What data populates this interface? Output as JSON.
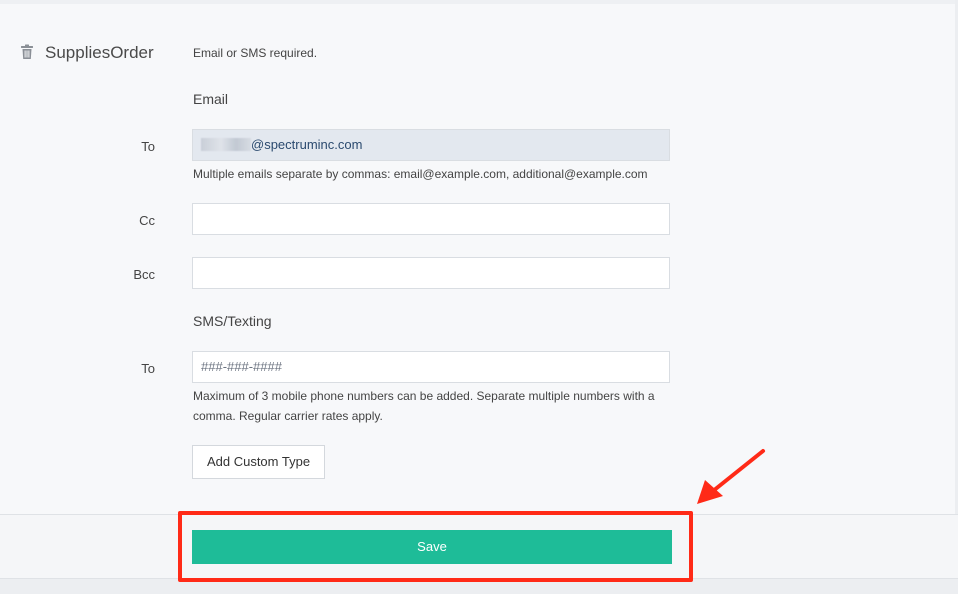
{
  "order": {
    "name": "SuppliesOrder",
    "requirement_note": "Email or SMS required."
  },
  "email": {
    "section_title": "Email",
    "to_label": "To",
    "to_value_suffix": "@spectruminc.com",
    "to_hint": "Multiple emails separate by commas: email@example.com, additional@example.com",
    "cc_label": "Cc",
    "cc_value": "",
    "bcc_label": "Bcc",
    "bcc_value": ""
  },
  "sms": {
    "section_title": "SMS/Texting",
    "to_label": "To",
    "to_placeholder": "###-###-####",
    "hint": "Maximum of 3 mobile phone numbers can be added. Separate multiple numbers with a comma. Regular carrier rates apply."
  },
  "buttons": {
    "add_custom_type": "Add Custom Type",
    "save": "Save"
  },
  "colors": {
    "save_button": "#1ebc98",
    "highlight": "#ff2a17",
    "filled_input": "#e3e8ef"
  },
  "icons": {
    "delete": "trash-icon",
    "annotation": "arrow-icon"
  }
}
